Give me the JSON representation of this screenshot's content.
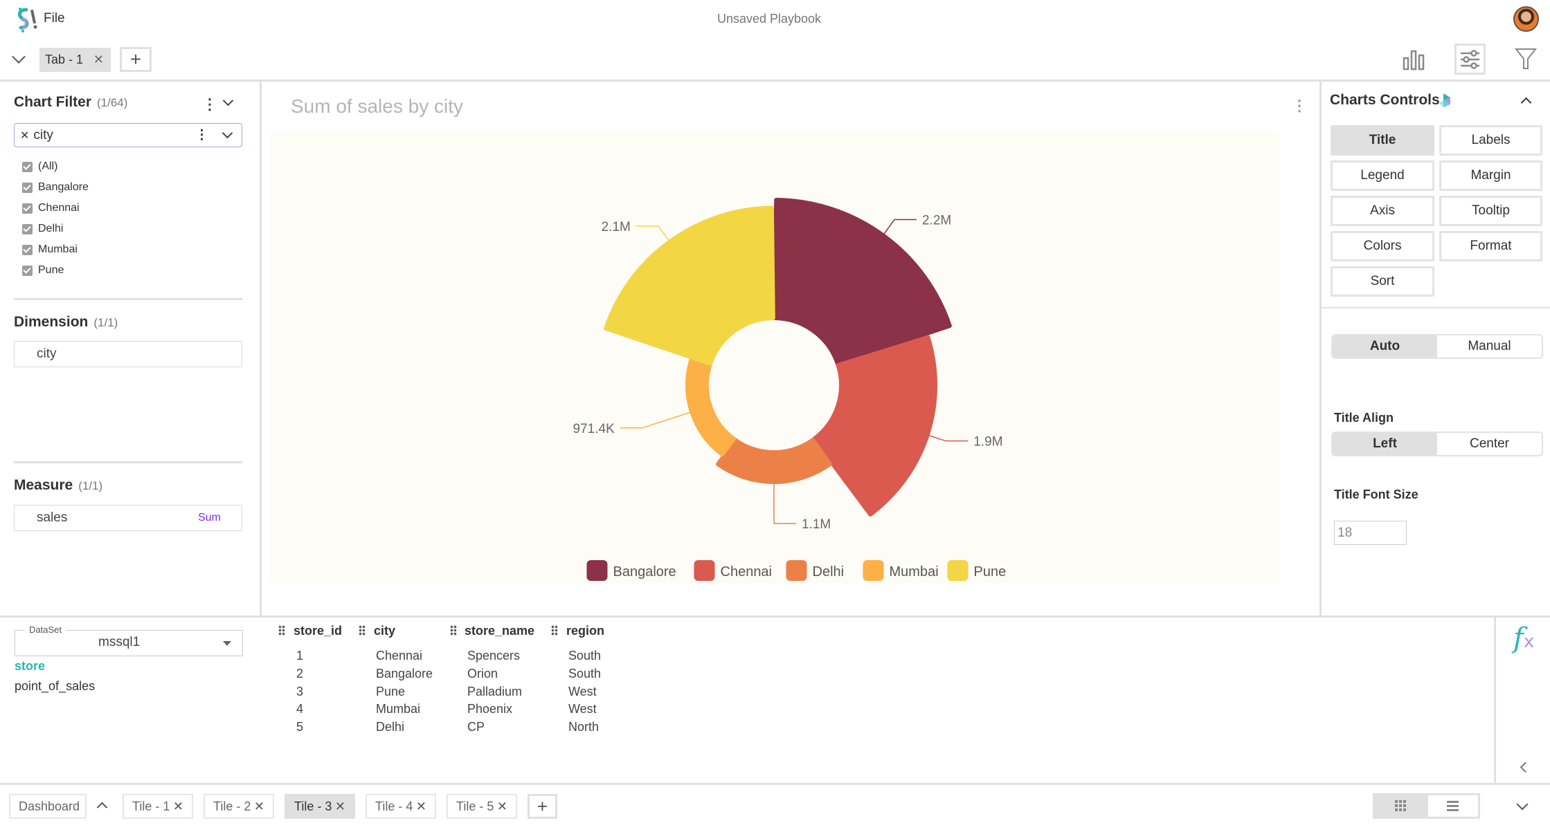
{
  "header": {
    "menu_file": "File",
    "title": "Unsaved Playbook",
    "tabs": [
      {
        "label": "Tab - 1"
      }
    ]
  },
  "left": {
    "chart_filter": {
      "title": "Chart Filter",
      "count": "(1/64)",
      "field": "city",
      "options": [
        "(All)",
        "Bangalore",
        "Chennai",
        "Delhi",
        "Mumbai",
        "Pune"
      ]
    },
    "dimension": {
      "title": "Dimension",
      "count": "(1/1)",
      "value": "city"
    },
    "measure": {
      "title": "Measure",
      "count": "(1/1)",
      "value": "sales",
      "agg": "Sum"
    }
  },
  "chart": {
    "title": "Sum of sales by city"
  },
  "chart_data": {
    "type": "pie",
    "variant": "rose (nightingale), donut",
    "title": "Sum of sales by city",
    "categories": [
      "Bangalore",
      "Chennai",
      "Delhi",
      "Mumbai",
      "Pune"
    ],
    "values": [
      2200000,
      1900000,
      1100000,
      971400,
      2100000
    ],
    "labels": [
      "2.2M",
      "1.9M",
      "1.1M",
      "971.4K",
      "2.1M"
    ],
    "colors": [
      "#8b3148",
      "#da5a50",
      "#ec8147",
      "#fdb045",
      "#f2d644"
    ],
    "legend": "bottom"
  },
  "controls": {
    "title": "Charts Controls",
    "buttons": [
      "Title",
      "Labels",
      "Legend",
      "Margin",
      "Axis",
      "Tooltip",
      "Colors",
      "Format",
      "Sort"
    ],
    "active": "Title",
    "mode": [
      "Auto",
      "Manual"
    ],
    "title_align_label": "Title Align",
    "title_align": [
      "Left",
      "Center"
    ],
    "font_size_label": "Title Font Size",
    "font_size": "18"
  },
  "data_panel": {
    "dataset_label": "DataSet",
    "dataset": "mssql1",
    "tables": [
      "store",
      "point_of_sales"
    ],
    "active_table": "store",
    "columns": [
      "store_id",
      "city",
      "store_name",
      "region"
    ],
    "rows": [
      [
        "1",
        "Chennai",
        "Spencers",
        "South"
      ],
      [
        "2",
        "Bangalore",
        "Orion",
        "South"
      ],
      [
        "3",
        "Pune",
        "Palladium",
        "West"
      ],
      [
        "4",
        "Mumbai",
        "Phoenix",
        "West"
      ],
      [
        "5",
        "Delhi",
        "CP",
        "North"
      ]
    ]
  },
  "footer": {
    "dashboard": "Dashboard",
    "tiles": [
      "Tile - 1",
      "Tile - 2",
      "Tile - 3",
      "Tile - 4",
      "Tile - 5"
    ],
    "active_tile": "Tile - 3"
  },
  "accent": "#2bb5b0"
}
